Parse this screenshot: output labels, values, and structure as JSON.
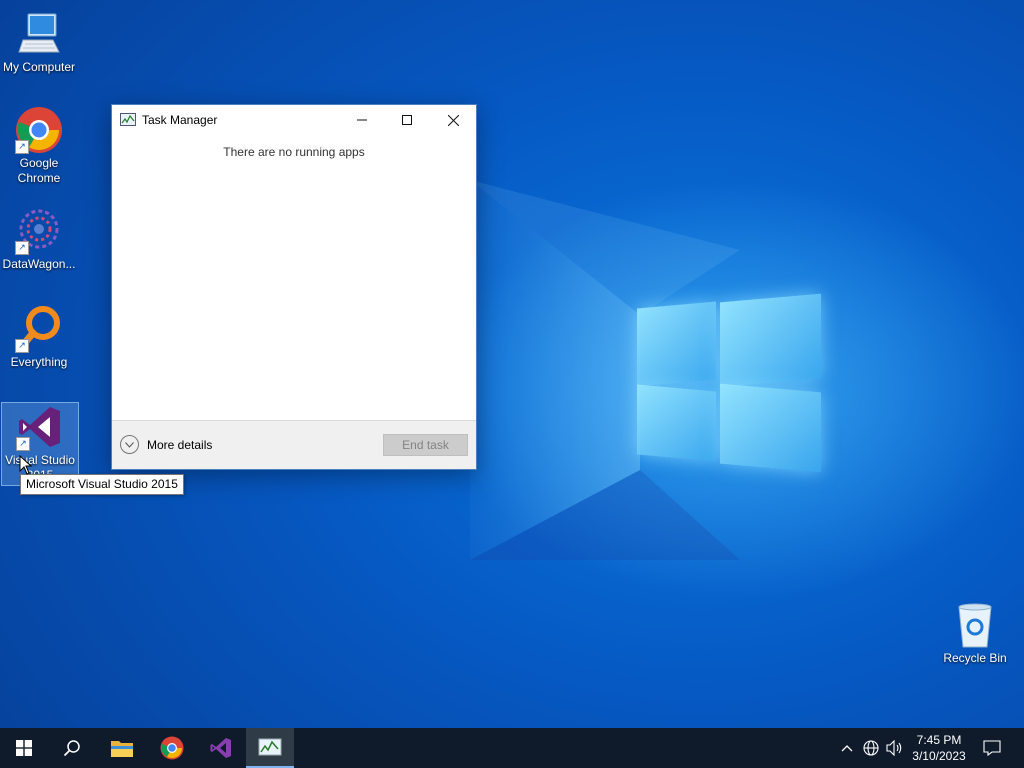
{
  "desktop": {
    "icons": [
      {
        "label": "My Computer"
      },
      {
        "label": "Google Chrome"
      },
      {
        "label": "DataWagon..."
      },
      {
        "label": "Everything"
      },
      {
        "label": "Visual Studio 2015"
      },
      {
        "label": "Recycle Bin"
      }
    ],
    "tooltip": "Microsoft Visual Studio 2015"
  },
  "task_manager": {
    "title": "Task Manager",
    "empty_message": "There are no running apps",
    "more_details_label": "More details",
    "end_task_label": "End task",
    "controls": {
      "minimize": "minimize-icon",
      "maximize": "maximize-icon",
      "close": "close-icon"
    }
  },
  "taskbar": {
    "items": [
      "start-icon",
      "search-icon",
      "file-explorer-icon",
      "chrome-icon",
      "visual-studio-icon",
      "task-manager-icon"
    ],
    "active_item": "task-manager-icon",
    "clock": {
      "time": "7:45 PM",
      "date": "3/10/2023"
    },
    "tray": [
      "show-hidden-icons-icon",
      "network-icon",
      "volume-icon",
      "notification-center-icon"
    ]
  },
  "colors": {
    "wallpaper": "#0658c2",
    "taskbar": "#0f1b2b",
    "visual_studio": "#68217a",
    "chrome_red": "#db4437",
    "chrome_yellow": "#f4b400",
    "chrome_green": "#0f9d58",
    "chrome_blue": "#4285f4",
    "everything_orange": "#f28a1c"
  }
}
